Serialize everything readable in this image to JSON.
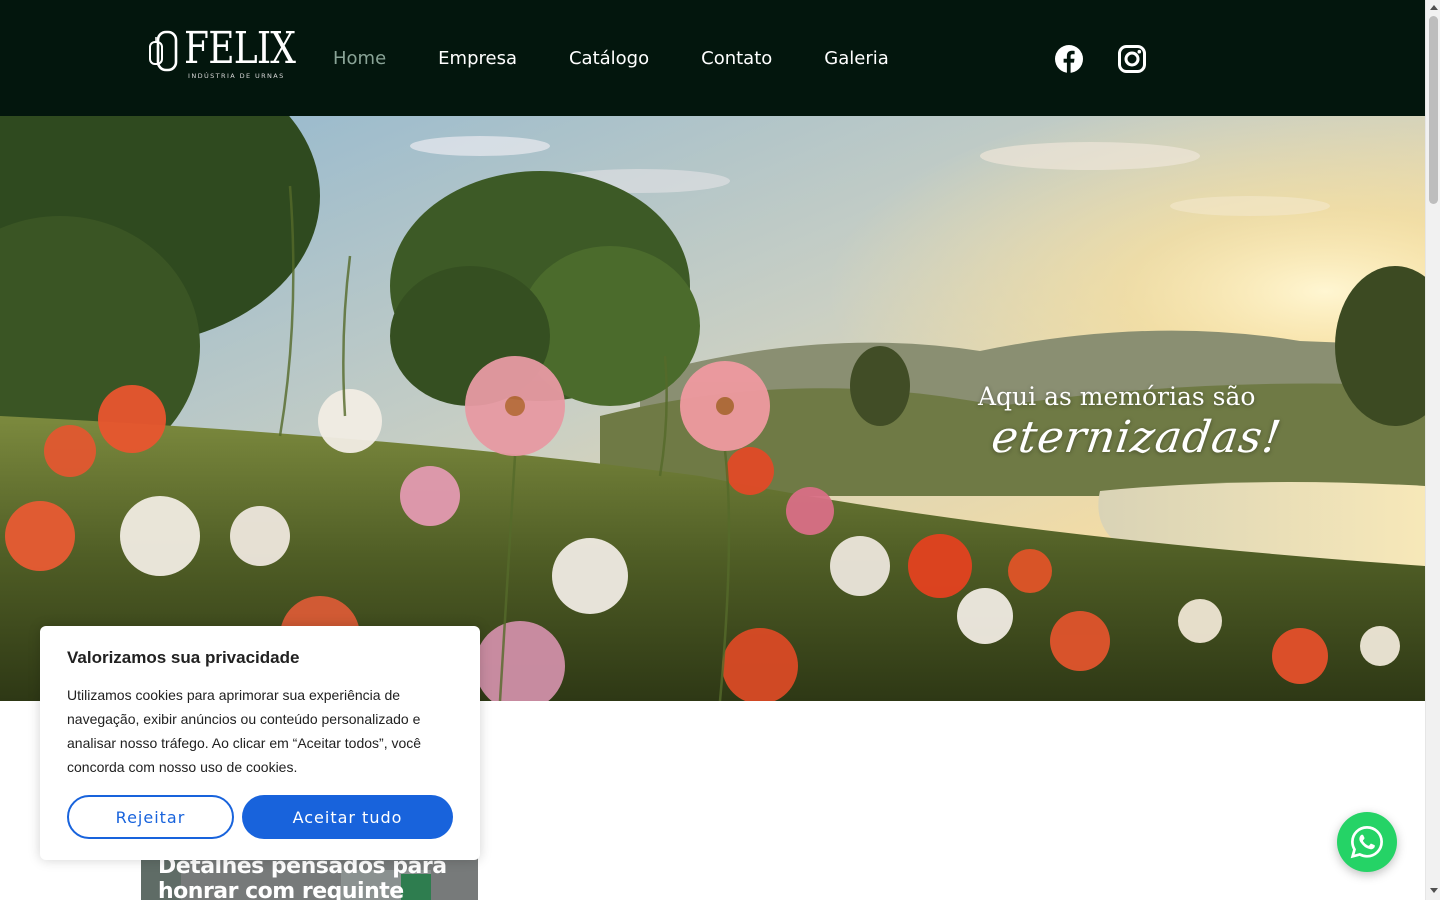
{
  "brand": {
    "name": "FELIX",
    "tagline": "INDÚSTRIA DE URNAS"
  },
  "nav": {
    "items": [
      {
        "label": "Home",
        "active": true
      },
      {
        "label": "Empresa",
        "active": false
      },
      {
        "label": "Catálogo",
        "active": false
      },
      {
        "label": "Contato",
        "active": false
      },
      {
        "label": "Galeria",
        "active": false
      }
    ]
  },
  "social": {
    "icons": [
      "facebook-icon",
      "instagram-icon"
    ]
  },
  "hero": {
    "title": "Aqui as memórias são",
    "script": "eternizadas!"
  },
  "teaser": {
    "title": "Detalhes pensados para honrar com requinte"
  },
  "cookie_banner": {
    "title": "Valorizamos sua privacidade",
    "text": "Utilizamos cookies para aprimorar sua experiência de navegação, exibir anúncios ou conteúdo personalizado e analisar nosso tráfego. Ao clicar em “Aceitar todos”, você concorda com nosso uso de cookies.",
    "reject_label": "Rejeitar",
    "accept_label": "Aceitar tudo"
  },
  "colors": {
    "header_bg": "#03160d",
    "nav_active": "#8aa497",
    "accent_blue": "#1863dc",
    "whatsapp_green": "#25d366"
  },
  "floating": {
    "icon": "whatsapp-icon"
  }
}
